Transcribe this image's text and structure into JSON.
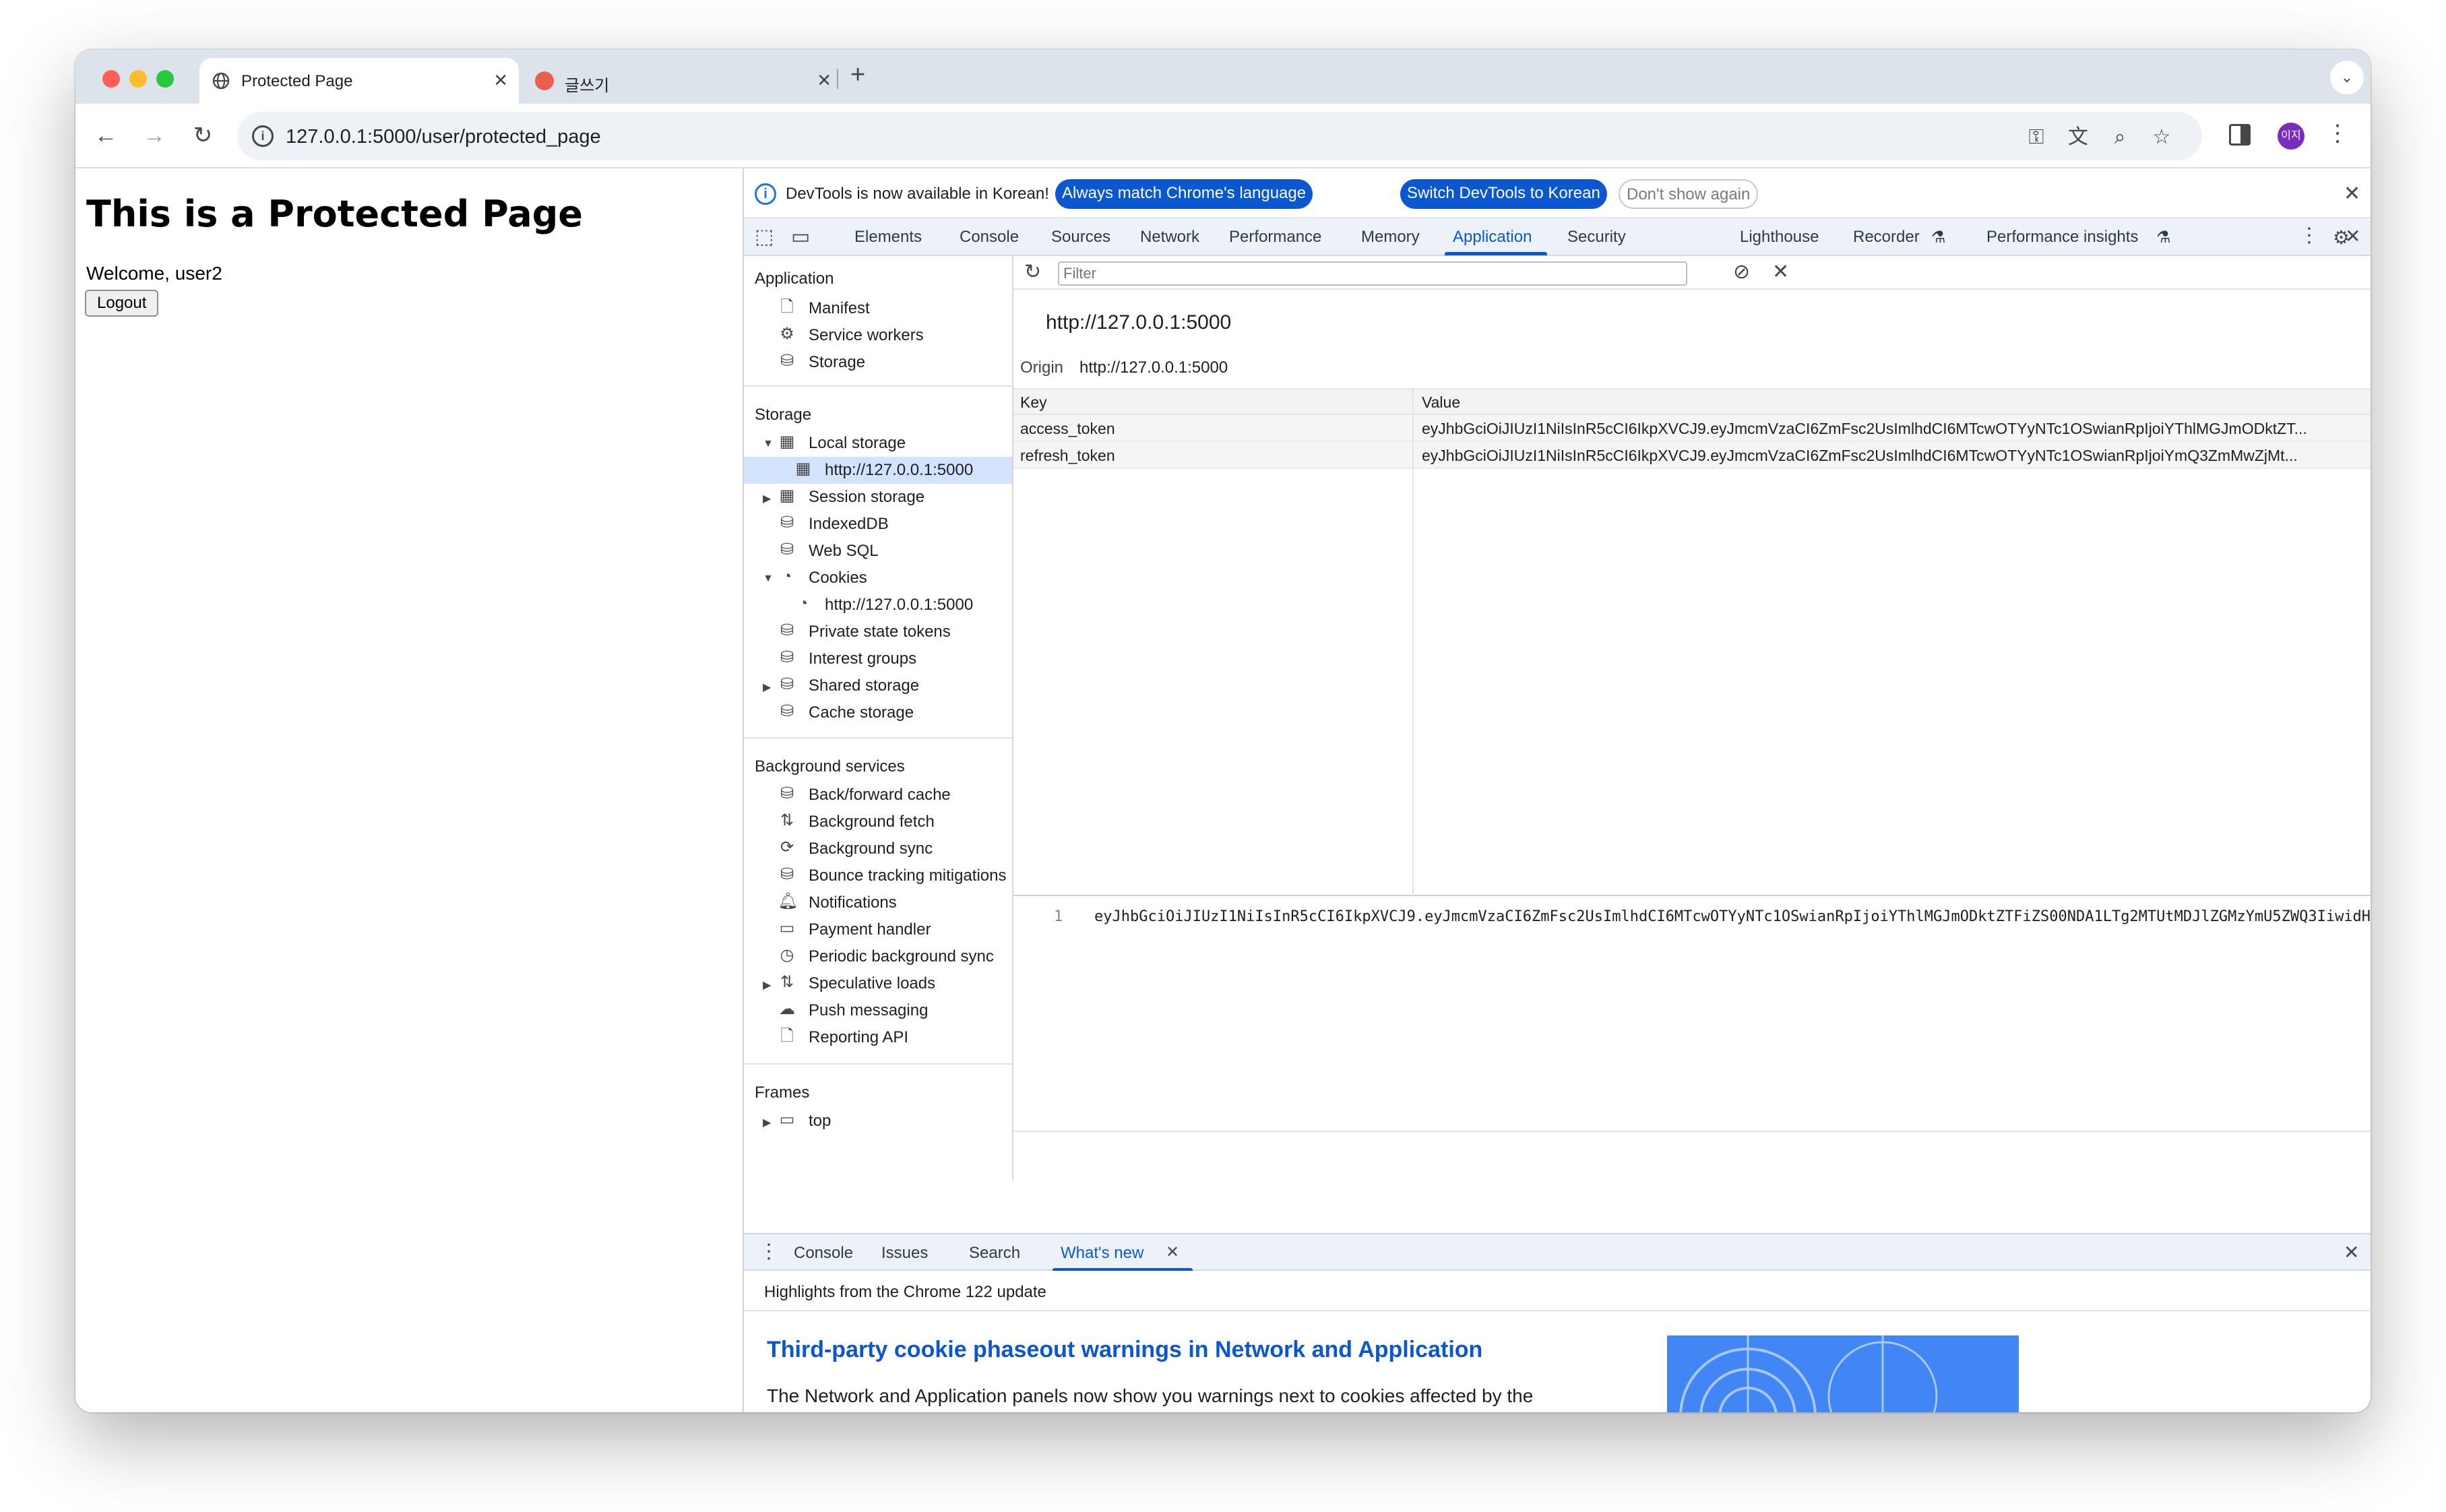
{
  "window": {
    "tabs": [
      {
        "title": "Protected Page",
        "active": true
      },
      {
        "title": "글쓰기",
        "active": false
      }
    ],
    "new_tab_label": "+",
    "address": "127.0.0.1:5000/user/protected_page",
    "profile_initials": "이지"
  },
  "page": {
    "heading": "This is a Protected Page",
    "welcome": "Welcome, user2",
    "logout_label": "Logout"
  },
  "devtools": {
    "infobar": {
      "message": "DevTools is now available in Korean!",
      "match_language": "Always match Chrome's language",
      "switch_korean": "Switch DevTools to Korean",
      "dont_show": "Don't show again"
    },
    "tabs": [
      "Elements",
      "Console",
      "Sources",
      "Network",
      "Performance",
      "Memory",
      "Application",
      "Security",
      "Lighthouse",
      "Recorder",
      "Performance insights"
    ],
    "active_tab": "Application",
    "sidebar": {
      "application_header": "Application",
      "application_items": [
        "Manifest",
        "Service workers",
        "Storage"
      ],
      "storage_header": "Storage",
      "storage_items": [
        "Local storage",
        "http://127.0.0.1:5000",
        "Session storage",
        "IndexedDB",
        "Web SQL",
        "Cookies",
        "http://127.0.0.1:5000",
        "Private state tokens",
        "Interest groups",
        "Shared storage",
        "Cache storage"
      ],
      "background_header": "Background services",
      "background_items": [
        "Back/forward cache",
        "Background fetch",
        "Background sync",
        "Bounce tracking mitigations",
        "Notifications",
        "Payment handler",
        "Periodic background sync",
        "Speculative loads",
        "Push messaging",
        "Reporting API"
      ],
      "frames_header": "Frames",
      "frames_items": [
        "top"
      ]
    },
    "filter_placeholder": "Filter",
    "origin_title": "http://127.0.0.1:5000",
    "origin_label": "Origin",
    "origin_value": "http://127.0.0.1:5000",
    "table": {
      "columns": [
        "Key",
        "Value"
      ],
      "rows": [
        {
          "key": "access_token",
          "value": "eyJhbGciOiJIUzI1NiIsInR5cCI6IkpXVCJ9.eyJmcmVzaCI6ZmFsc2UsImlhdCI6MTcwOTYyNTc1OSwianRpIjoiYThlMGJmODktZT..."
        },
        {
          "key": "refresh_token",
          "value": "eyJhbGciOiJIUzI1NiIsInR5cCI6IkpXVCJ9.eyJmcmVzaCI6ZmFsc2UsImlhdCI6MTcwOTYyNTc1OSwianRpIjoiYmQ3ZmMwZjMt..."
        }
      ]
    },
    "preview": {
      "line_number": "1",
      "code": "eyJhbGciOiJIUzI1NiIsInR5cCI6IkpXVCJ9.eyJmcmVzaCI6ZmFsc2UsImlhdCI6MTcwOTYyNTc1OSwianRpIjoiYThlMGJmODktZTFiZS00NDA1LTg2MTUtMDJlZGMzYmU5ZWQ3IiwidH"
    },
    "drawer": {
      "tabs": [
        "Console",
        "Issues",
        "Search",
        "What's new"
      ],
      "active_tab": "What's new",
      "subtitle": "Highlights from the Chrome 122 update",
      "headline": "Third-party cookie phaseout warnings in Network and Application",
      "body": "The Network and Application panels now show you warnings next to cookies affected by the third-party cookie restrictions from Tracking Protection."
    }
  },
  "colors": {
    "accent": "#0b57d0",
    "tabstrip": "#dde3ea",
    "devtools_bar": "#edf2fa",
    "selected_row": "#d3e3fd",
    "close_light": "#ff5f57",
    "minimize_light": "#febc2e",
    "zoom_light": "#28c840"
  }
}
